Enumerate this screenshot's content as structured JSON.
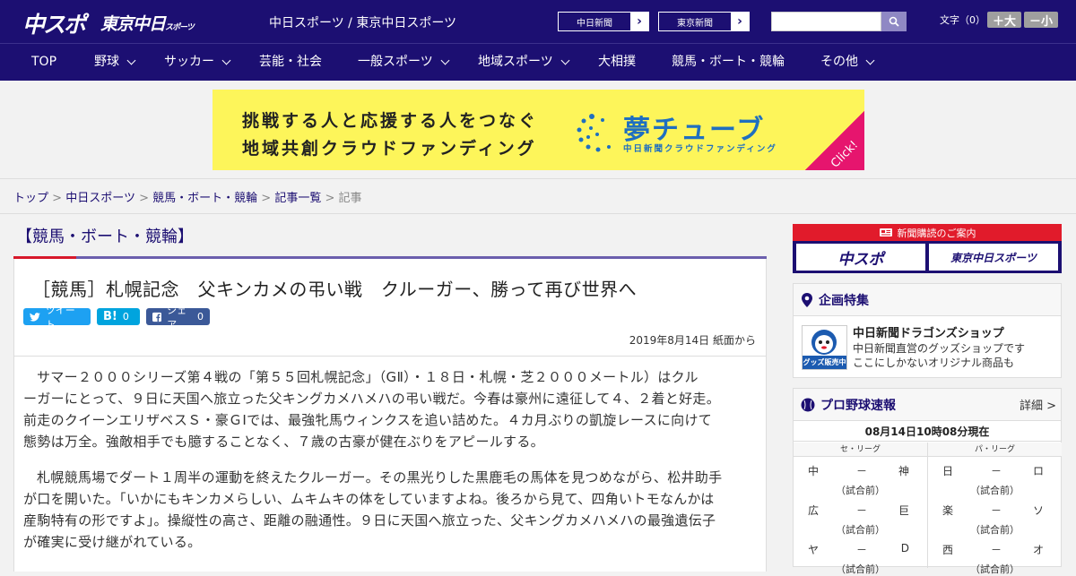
{
  "header": {
    "logo_main": "中スポ",
    "logo_tokyo": "東京中日",
    "logo_tokyo_small": "スポーツ",
    "site_title": "中日スポーツ / 東京中日スポーツ",
    "newspaper_buttons": [
      "中日新聞",
      "東京新聞"
    ],
    "search_icon": "search-icon",
    "font_size_label": "文字（0）",
    "font_bigger": "＋大",
    "font_smaller": "－小"
  },
  "nav": {
    "items": [
      {
        "label": "TOP",
        "dropdown": false
      },
      {
        "label": "野球",
        "dropdown": true
      },
      {
        "label": "サッカー",
        "dropdown": true
      },
      {
        "label": "芸能・社会",
        "dropdown": false
      },
      {
        "label": "一般スポーツ",
        "dropdown": true
      },
      {
        "label": "地域スポーツ",
        "dropdown": true
      },
      {
        "label": "大相撲",
        "dropdown": false
      },
      {
        "label": "競馬・ボート・競輪",
        "dropdown": false
      },
      {
        "label": "その他",
        "dropdown": true
      }
    ]
  },
  "banner": {
    "line1": "挑戦する人と応援する人をつなぐ",
    "line2": "地域共創クラウドファンディング",
    "brand": "夢チューブ",
    "brand_sub": "中日新聞クラウドファンディング",
    "click": "Click!",
    "colors": {
      "bg": "#fdf55a",
      "brand": "#1f6fc0",
      "click": "#e6156e"
    }
  },
  "breadcrumb": {
    "items": [
      "トップ",
      "中日スポーツ",
      "競馬・ボート・競輪",
      "記事一覧"
    ],
    "current": "記事",
    "separator": ">"
  },
  "article": {
    "category": "【競馬・ボート・競輪】",
    "headline": "［競馬］札幌記念　父キンカメの弔い戦　クルーガー、勝って再び世界へ",
    "share": {
      "tweet": "ツイート",
      "hatena": "B!",
      "hatena_count": "0",
      "facebook": "シェア",
      "facebook_count": "0"
    },
    "dateline": "2019年8月14日 紙面から",
    "paragraphs": [
      [
        "サマー２０００シリーズ第４戦の「第５５回札幌記念」（GⅡ）・１８日・札幌・芝２０００メートル）はクル",
        "ーガーにとって、９日に天国へ旅立った父キングカメハメハの弔い戦だ。今春は豪州に遠征して４、２着と好走。",
        "前走のクイーンエリザベスＳ・豪ＧⅠでは、最強牝馬ウィンクスを追い詰めた。４カ月ぶりの凱旋レースに向けて",
        "態勢は万全。強敵相手でも臆することなく、７歳の古豪が健在ぶりをアピールする。"
      ],
      [
        "札幌競馬場でダート１周半の運動を終えたクルーガー。その黒光りした黒鹿毛の馬体を見つめながら、松井助手",
        "が口を開いた。「いかにもキンカメらしい、ムキムキの体をしていますよね。後ろから見て、四角いトモなんかは",
        "産駒特有の形ですよ」。操縦性の高さ、距離の融通性。９日に天国へ旅立った、父キングカメハメハの最強遺伝子",
        "が確実に受け継がれている。"
      ]
    ]
  },
  "sidebar": {
    "subscribe": {
      "title": "新聞購読のご案内",
      "buttons": [
        "中スポ",
        "東京中日スポーツ"
      ]
    },
    "feature": {
      "title": "企画特集",
      "thumb_text": "グッズ販売中",
      "item_title": "中日新聞ドラゴンズショップ",
      "item_desc": [
        "中日新聞直営のグッズショップです",
        "ここにしかないオリジナル商品も"
      ]
    },
    "baseball": {
      "title": "プロ野球速報",
      "more": "詳細 >",
      "timestamp": "08月14日10時08分現在",
      "central_label": "セ・リーグ",
      "pacific_label": "パ・リーグ",
      "central": [
        {
          "home": "中",
          "vs": "－",
          "away": "神",
          "status": "（試合前）"
        },
        {
          "home": "広",
          "vs": "－",
          "away": "巨",
          "status": "（試合前）"
        },
        {
          "home": "ヤ",
          "vs": "－",
          "away": "D",
          "status": "（試合前）"
        }
      ],
      "pacific": [
        {
          "home": "日",
          "vs": "－",
          "away": "ロ",
          "status": "（試合前）"
        },
        {
          "home": "楽",
          "vs": "－",
          "away": "ソ",
          "status": "（試合前）"
        },
        {
          "home": "西",
          "vs": "－",
          "away": "オ",
          "status": "（試合前）"
        }
      ]
    }
  },
  "colors": {
    "brand": "#1c0f72",
    "accent_red": "#d7182a",
    "twitter": "#1da1f2",
    "hatena": "#00a4de",
    "facebook": "#3b5998"
  }
}
